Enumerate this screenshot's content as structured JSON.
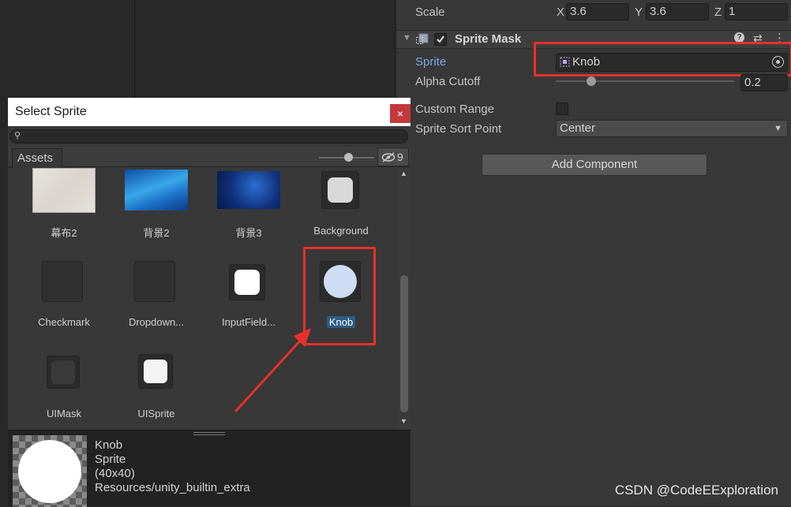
{
  "inspector": {
    "scale": {
      "label": "Scale",
      "x_axis": "X",
      "x": "3.6",
      "y_axis": "Y",
      "y": "3.6",
      "z_axis": "Z",
      "z": "1"
    },
    "component": {
      "title": "Sprite Mask",
      "sprite_label": "Sprite",
      "sprite_value": "Knob",
      "alpha_cutoff_label": "Alpha Cutoff",
      "alpha_cutoff_value": "0.2",
      "alpha_cutoff_fraction": 0.2,
      "custom_range_label": "Custom Range",
      "sort_point_label": "Sprite Sort Point",
      "sort_point_value": "Center"
    },
    "add_component": "Add Component"
  },
  "picker": {
    "title": "Select Sprite",
    "close": "×",
    "tab": "Assets",
    "hidden_count": "9",
    "items": [
      {
        "name": "幕布2"
      },
      {
        "name": "背景2"
      },
      {
        "name": "背景3"
      },
      {
        "name": "Background"
      },
      {
        "name": "Checkmark"
      },
      {
        "name": "Dropdown..."
      },
      {
        "name": "InputField..."
      },
      {
        "name": "Knob"
      },
      {
        "name": "UIMask"
      },
      {
        "name": "UISprite"
      }
    ],
    "preview": {
      "name": "Knob",
      "type": "Sprite",
      "size": "(40x40)",
      "path": "Resources/unity_builtin_extra"
    }
  },
  "watermark": "CSDN @CodeEExploration",
  "colors": {
    "highlight": "#e8312a",
    "selection": "#2c5d87",
    "sprite_label": "#7ba7e8"
  }
}
